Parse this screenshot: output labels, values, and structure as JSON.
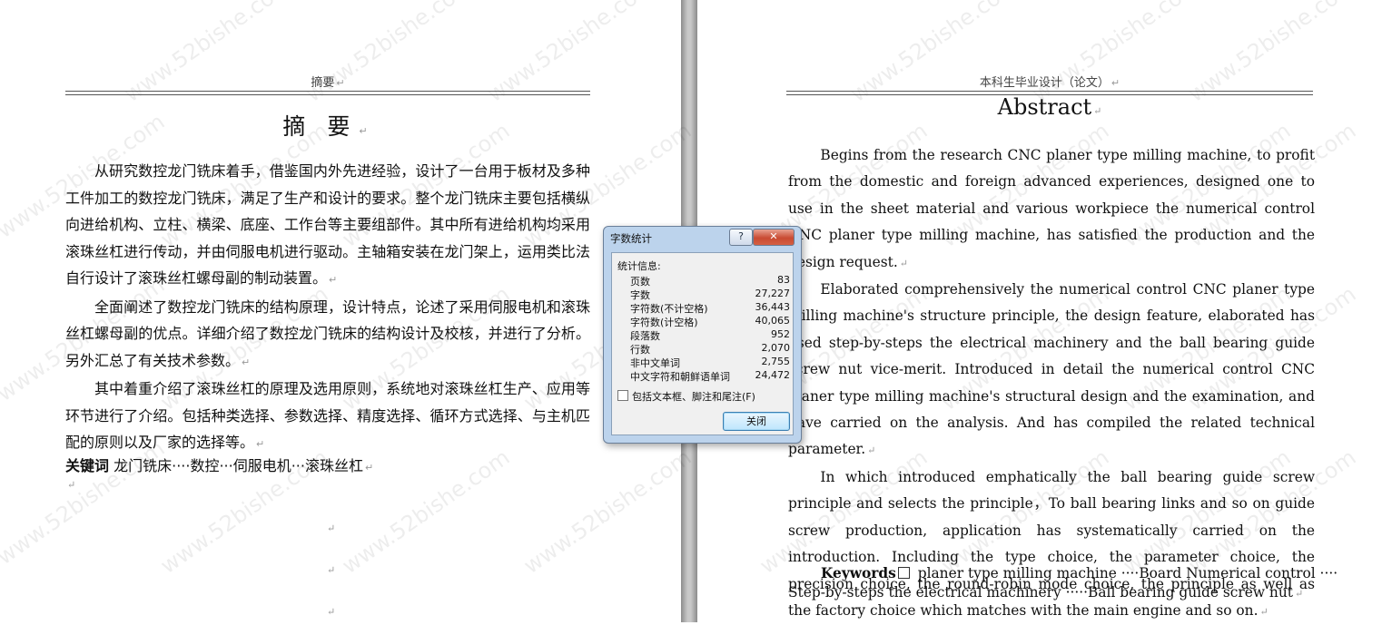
{
  "left_page": {
    "header": "摘要",
    "title": "摘 要",
    "paragraphs": [
      "从研究数控龙门铣床着手，借鉴国内外先进经验，设计了一台用于板材及多种工件加工的数控龙门铣床，满足了生产和设计的要求。整个龙门铣床主要包括横纵向进给机构、立柱、横梁、底座、工作台等主要组部件。其中所有进给机构均采用滚珠丝杠进行传动，并由伺服电机进行驱动。主轴箱安装在龙门架上，运用类比法自行设计了滚珠丝杠螺母副的制动装置。",
      "全面阐述了数控龙门铣床的结构原理，设计特点，论述了采用伺服电机和滚珠丝杠螺母副的优点。详细介绍了数控龙门铣床的结构设计及校核，并进行了分析。另外汇总了有关技术参数。",
      "其中着重介绍了滚珠丝杠的原理及选用原则，系统地对滚珠丝杠生产、应用等环节进行了介绍。包括种类选择、参数选择、精度选择、循环方式选择、与主机匹配的原则以及厂家的选择等。"
    ],
    "keywords_label": "关键词",
    "keywords": "  龙门铣床····数控···伺服电机···滚珠丝杠",
    "paragraph_mark": "↵"
  },
  "right_page": {
    "header": "本科生毕业设计（论文）",
    "title": "Abstract",
    "paragraphs": [
      "Begins from the research CNC planer type milling machine, to profit from the domestic and foreign advanced experiences, designed one to use in the sheet material and various workpiece the numerical control CNC planer type milling machine, has satisfied the production and the design request.",
      "Elaborated comprehensively the numerical control CNC planer type milling machine's structure principle, the design feature, elaborated has used step-by-steps the electrical machinery and the ball bearing guide screw nut vice-merit. Introduced in detail the numerical control CNC planer type milling machine's structural design and the examination, and have carried on the analysis. And has compiled the related technical parameter.",
      "In which introduced emphatically the ball bearing guide screw principle and selects the principle，To ball bearing links and so on guide screw production, application has systematically carried on the introduction. Including the type choice, the parameter choice, the precision choice, the round-robin mode choice, the principle as well as the factory choice which matches with the main engine and so on."
    ],
    "keywords_label": "Keywords",
    "keywords_line1": " planer type milling machine ····Board Numerical control ····",
    "keywords_line2": "Step-by-steps the electrical machinery ·····Ball bearing guide screw nut"
  },
  "watermark": "www.52bishe.com",
  "dialog": {
    "title": "字数统计",
    "help_label": "?",
    "close_x_label": "✕",
    "stats_heading": "统计信息:",
    "stats": [
      {
        "label": "页数",
        "value": "83"
      },
      {
        "label": "字数",
        "value": "27,227"
      },
      {
        "label": "字符数(不计空格)",
        "value": "36,443"
      },
      {
        "label": "字符数(计空格)",
        "value": "40,065"
      },
      {
        "label": "段落数",
        "value": "952"
      },
      {
        "label": "行数",
        "value": "2,070"
      },
      {
        "label": "非中文单词",
        "value": "2,755"
      },
      {
        "label": "中文字符和朝鲜语单词",
        "value": "24,472"
      }
    ],
    "include_label": "包括文本框、脚注和尾注(F)",
    "close_label": "关闭"
  }
}
